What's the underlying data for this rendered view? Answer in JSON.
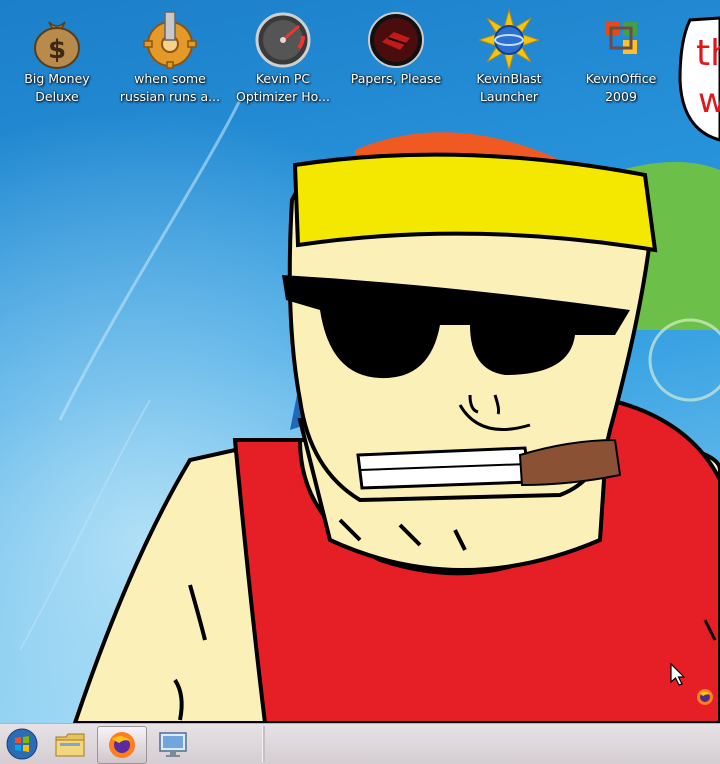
{
  "desktop": {
    "icons": [
      {
        "label": "Big Money Deluxe",
        "icon": "money-bag-icon"
      },
      {
        "label": "when some russian runs a...",
        "icon": "gear-icon"
      },
      {
        "label": "Kevin PC Optimizer Ho...",
        "icon": "speedometer-icon"
      },
      {
        "label": "Papers, Please",
        "icon": "papers-please-icon"
      },
      {
        "label": "KevinBlast Launcher",
        "icon": "kevinblast-icon"
      },
      {
        "label": "KevinOffice 2009",
        "icon": "office-icon"
      }
    ],
    "speech_bubble_text": [
      "th",
      "w"
    ]
  },
  "taskbar": {
    "start_icon": "windows-orb-icon",
    "pinned": [
      "file-explorer-icon",
      "firefox-icon",
      "remote-desktop-icon"
    ],
    "tray": [
      "firefox-icon"
    ]
  },
  "colors": {
    "sky": "#1f86d0",
    "headband": "#f5e800",
    "shirt": "#e61e25",
    "skin": "#fbf1b8",
    "cigar": "#8b5134"
  }
}
